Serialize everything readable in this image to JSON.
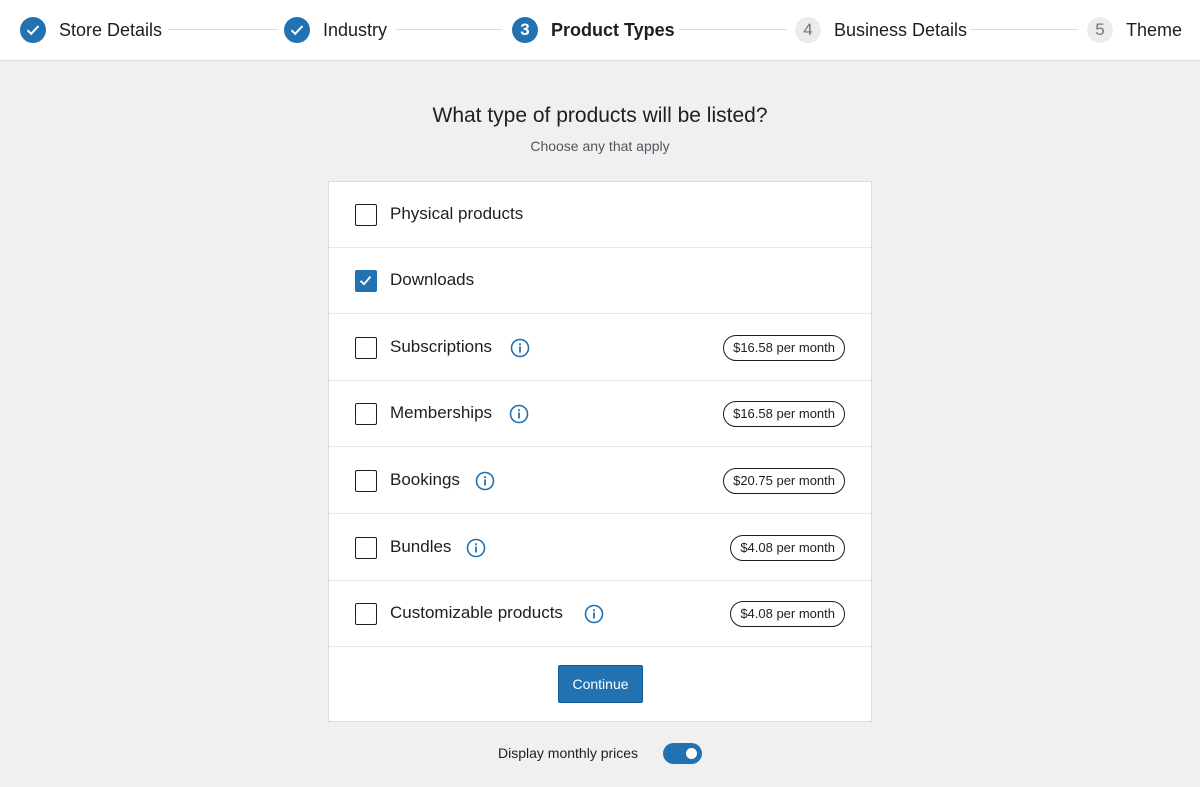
{
  "steps": [
    {
      "number": "1",
      "label": "Store Details",
      "state": "done"
    },
    {
      "number": "2",
      "label": "Industry",
      "state": "done"
    },
    {
      "number": "3",
      "label": "Product Types",
      "state": "current"
    },
    {
      "number": "4",
      "label": "Business Details",
      "state": "todo"
    },
    {
      "number": "5",
      "label": "Theme",
      "state": "todo"
    }
  ],
  "heading": "What type of products will be listed?",
  "subheading": "Choose any that apply",
  "products": [
    {
      "label": "Physical products",
      "checked": false,
      "info_icon": false,
      "price": ""
    },
    {
      "label": "Downloads",
      "checked": true,
      "info_icon": false,
      "price": ""
    },
    {
      "label": "Subscriptions",
      "checked": false,
      "info_icon": true,
      "price": "$16.58 per month"
    },
    {
      "label": "Memberships",
      "checked": false,
      "info_icon": true,
      "price": "$16.58 per month"
    },
    {
      "label": "Bookings",
      "checked": false,
      "info_icon": true,
      "price": "$20.75 per month"
    },
    {
      "label": "Bundles",
      "checked": false,
      "info_icon": true,
      "price": "$4.08 per month"
    },
    {
      "label": "Customizable products",
      "checked": false,
      "info_icon": true,
      "price": "$4.08 per month"
    }
  ],
  "continue_label": "Continue",
  "monthly_toggle": {
    "label": "Display monthly prices",
    "on": true
  },
  "colors": {
    "accent": "#2271b1",
    "background": "#f0f0f1",
    "border": "#dcdcde"
  }
}
